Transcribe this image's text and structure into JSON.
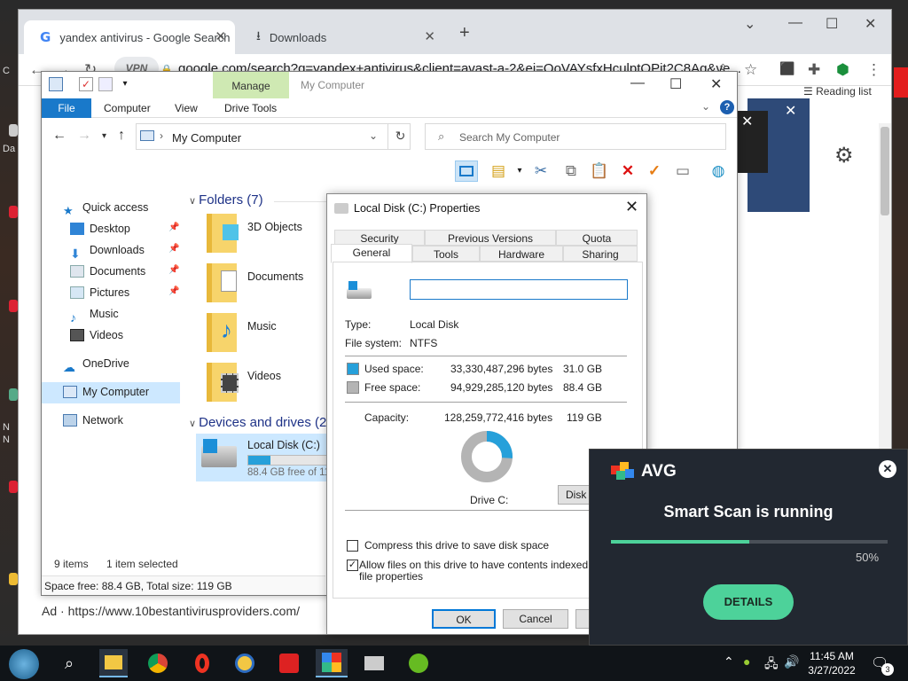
{
  "browser": {
    "tabs": [
      {
        "label": "yandex antivirus - Google Search",
        "icon": "google-g-icon"
      },
      {
        "label": "Downloads",
        "icon": "download-icon"
      }
    ],
    "vpn_label": "VPN",
    "url": "google.com/search?q=yandex+antivirus&client=avast-a-2&ei=QoVAYsfxHculptQPjt2C8Ag&ve...",
    "reading_list": "Reading list",
    "ad_line": "Ad · https://www.10bestantivirusproviders.com/"
  },
  "explorer": {
    "window_title": "My Computer",
    "manage_tab": "Manage",
    "ribbon_tabs": [
      "File",
      "Computer",
      "View",
      "Drive Tools"
    ],
    "address": "My Computer",
    "search_placeholder": "Search My Computer",
    "nav": {
      "quick_access": "Quick access",
      "desktop": "Desktop",
      "downloads": "Downloads",
      "documents": "Documents",
      "pictures": "Pictures",
      "music": "Music",
      "videos": "Videos",
      "onedrive": "OneDrive",
      "my_computer": "My Computer",
      "network": "Network"
    },
    "folders_header": "Folders (7)",
    "folders": [
      "3D Objects",
      "Documents",
      "Music",
      "Videos"
    ],
    "devices_header": "Devices and drives (2",
    "drive": {
      "name": "Local Disk (C:)",
      "free_text": "88.4 GB free of 11",
      "used_fraction": 0.26
    },
    "status_items": "9 items",
    "status_selected": "1 item selected",
    "space_info": "Space free: 88.4 GB, Total size: 119 GB"
  },
  "properties": {
    "title": "Local Disk (C:) Properties",
    "tabs_row1": [
      "Security",
      "Previous Versions",
      "Quota"
    ],
    "tabs_row2": [
      "General",
      "Tools",
      "Hardware",
      "Sharing"
    ],
    "name_value": "",
    "type_label": "Type:",
    "type_value": "Local Disk",
    "fs_label": "File system:",
    "fs_value": "NTFS",
    "used_label": "Used space:",
    "used_bytes": "33,330,487,296 bytes",
    "used_gb": "31.0 GB",
    "free_label": "Free space:",
    "free_bytes": "94,929,285,120 bytes",
    "free_gb": "88.4 GB",
    "capacity_label": "Capacity:",
    "capacity_bytes": "128,259,772,416 bytes",
    "capacity_gb": "119 GB",
    "drive_label": "Drive C:",
    "disk_cleanup": "Disk C",
    "compress_label": "Compress this drive to save disk space",
    "compress_checked": false,
    "index_label_1": "Allow files on this drive to have contents indexed in add",
    "index_label_2": "file properties",
    "index_checked": true,
    "ok": "OK",
    "cancel": "Cancel",
    "colors": {
      "used": "#26a0da",
      "free": "#b4b4b4"
    }
  },
  "avg": {
    "brand": "AVG",
    "title": "Smart Scan is running",
    "progress_percent": 50,
    "progress_label": "50%",
    "details_button": "DETAILS"
  },
  "taskbar": {
    "time": "11:45 AM",
    "date": "3/27/2022",
    "notification_count": "3"
  }
}
